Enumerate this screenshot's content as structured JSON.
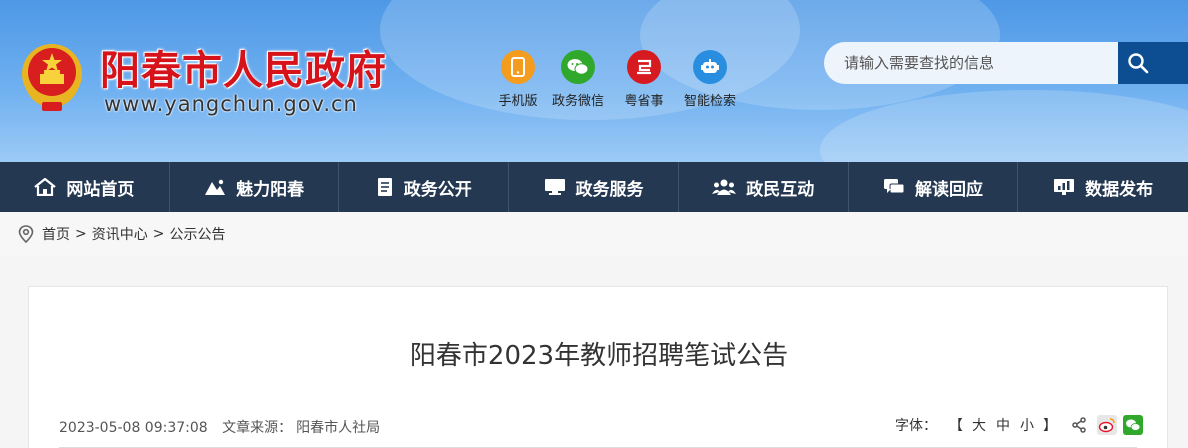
{
  "header": {
    "site_title": "阳春市人民政府",
    "site_url": "www.yangchun.gov.cn",
    "quick_links": [
      {
        "label": "手机版",
        "icon": "mobile-icon",
        "color": "#f39c1d"
      },
      {
        "label": "政务微信",
        "icon": "wechat-icon",
        "color": "#2fa82c"
      },
      {
        "label": "粤省事",
        "icon": "yue-service-icon",
        "color": "#d61a20"
      },
      {
        "label": "智能检索",
        "icon": "robot-icon",
        "color": "#2a8ee0"
      }
    ],
    "search": {
      "placeholder": "请输入需要查找的信息"
    }
  },
  "nav": [
    {
      "label": "网站首页",
      "icon": "home-icon"
    },
    {
      "label": "魅力阳春",
      "icon": "landscape-icon"
    },
    {
      "label": "政务公开",
      "icon": "document-icon"
    },
    {
      "label": "政务服务",
      "icon": "monitor-icon"
    },
    {
      "label": "政民互动",
      "icon": "people-icon"
    },
    {
      "label": "解读回应",
      "icon": "chat-icon"
    },
    {
      "label": "数据发布",
      "icon": "chart-icon"
    }
  ],
  "breadcrumb": [
    "首页",
    "资讯中心",
    "公示公告"
  ],
  "article": {
    "title": "阳春市2023年教师招聘笔试公告",
    "date": "2023-05-08 09:37:08",
    "source_label": "文章来源：",
    "source": "阳春市人社局",
    "font_label": "字体：",
    "bracket_open": "【",
    "bracket_close": "】",
    "font_sizes": [
      "大",
      "中",
      "小"
    ]
  },
  "colors": {
    "nav_bg": "#243852",
    "title_red": "#d6121a",
    "search_btn": "#0d4e92"
  }
}
